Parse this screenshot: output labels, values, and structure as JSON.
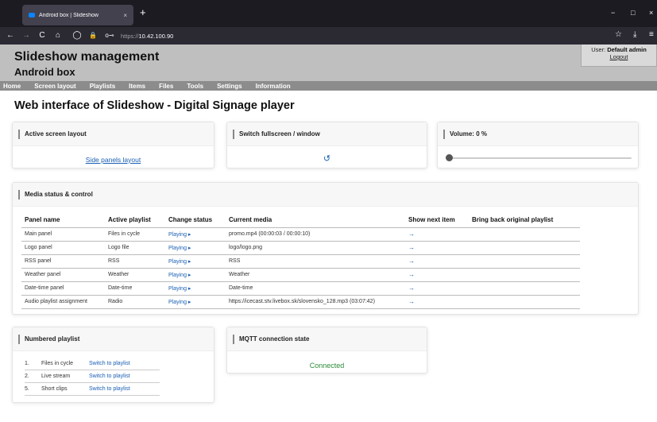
{
  "browser": {
    "tab_title": "Android box | Slideshow",
    "tab_close": "×",
    "new_tab": "+",
    "url_scheme": "https://",
    "url_host": "10.42.100.90",
    "window_controls": {
      "minimize": "−",
      "maximize": "□",
      "close": "×"
    },
    "nav_icons": {
      "back": "←",
      "forward": "→",
      "reload": "C",
      "home": "⌂",
      "shield": "◯",
      "lock": "🔒",
      "key": "o⊸",
      "bookmark": "☆",
      "download": "⤓",
      "menu": "≡"
    }
  },
  "header": {
    "title": "Slideshow management",
    "subtitle": "Android box",
    "user_label": "User:",
    "user_name": "Default admin",
    "logout": "Logout"
  },
  "menu": [
    "Home",
    "Screen layout",
    "Playlists",
    "Items",
    "Files",
    "Tools",
    "Settings",
    "Information"
  ],
  "page_title": "Web interface of Slideshow - Digital Signage player",
  "cards": {
    "active_layout": {
      "title": "Active screen layout",
      "link": "Side panels layout"
    },
    "fullscreen": {
      "title": "Switch fullscreen / window",
      "icon": "↺"
    },
    "volume": {
      "title": "Volume: 0 %",
      "level": 0
    },
    "media": {
      "title": "Media status & control",
      "columns": [
        "Panel name",
        "Active playlist",
        "Change status",
        "Current media",
        "Show next item",
        "Bring back original playlist"
      ],
      "rows": [
        {
          "panel": "Main panel",
          "playlist": "Files in cycle",
          "status": "Playing ▸",
          "media": "promo.mp4 (00:00:03 / 00:00:10)",
          "next": "→",
          "back": ""
        },
        {
          "panel": "Logo panel",
          "playlist": "Logo file",
          "status": "Playing ▸",
          "media": "logo/logo.png",
          "next": "→",
          "back": ""
        },
        {
          "panel": "RSS panel",
          "playlist": "RSS",
          "status": "Playing ▸",
          "media": "RSS",
          "next": "→",
          "back": ""
        },
        {
          "panel": "Weather panel",
          "playlist": "Weather",
          "status": "Playing ▸",
          "media": "Weather",
          "next": "→",
          "back": ""
        },
        {
          "panel": "Date-time panel",
          "playlist": "Date-time",
          "status": "Playing ▸",
          "media": "Date-time",
          "next": "→",
          "back": ""
        },
        {
          "panel": "Audio playlist assignment",
          "playlist": "Radio",
          "status": "Playing ▸",
          "media": "https://icecast.stv.livebox.sk/slovensko_128.mp3 (03:07:42)",
          "next": "→",
          "back": ""
        }
      ]
    },
    "numbered": {
      "title": "Numbered playlist",
      "items": [
        {
          "num": "1.",
          "name": "Files in cycle",
          "action": "Switch to playlist"
        },
        {
          "num": "2.",
          "name": "Live stream",
          "action": "Switch to playlist"
        },
        {
          "num": "5.",
          "name": "Short clips",
          "action": "Switch to playlist"
        }
      ]
    },
    "mqtt": {
      "title": "MQTT connection state",
      "state": "Connected"
    }
  },
  "colors": {
    "link": "#1a5fb4",
    "connected": "#2e8b3a",
    "header_bg": "#bfbfbf",
    "menu_bg": "#8c8c8c"
  }
}
